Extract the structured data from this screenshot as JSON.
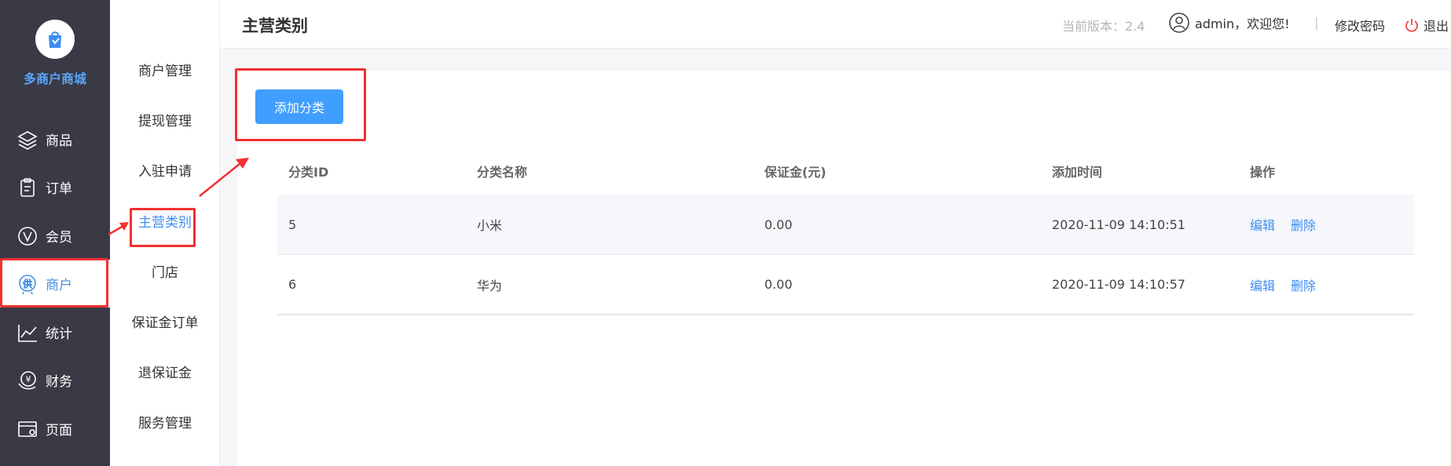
{
  "brand": {
    "name": "多商户商城",
    "logo_icon": "shopping-bag-icon"
  },
  "sidebar": {
    "items": [
      {
        "label": "商品",
        "icon": "layers-icon"
      },
      {
        "label": "订单",
        "icon": "clipboard-icon"
      },
      {
        "label": "会员",
        "icon": "vip-icon"
      },
      {
        "label": "商户",
        "icon": "supplier-icon",
        "active": true
      },
      {
        "label": "统计",
        "icon": "chart-icon"
      },
      {
        "label": "财务",
        "icon": "finance-icon"
      },
      {
        "label": "页面",
        "icon": "page-icon"
      }
    ]
  },
  "submenu": {
    "items": [
      {
        "label": "商户管理"
      },
      {
        "label": "提现管理"
      },
      {
        "label": "入驻申请"
      },
      {
        "label": "主营类别",
        "active": true
      },
      {
        "label": "门店"
      },
      {
        "label": "保证金订单"
      },
      {
        "label": "退保证金"
      },
      {
        "label": "服务管理"
      }
    ]
  },
  "header": {
    "title": "主营类别",
    "version": "当前版本：2.4",
    "user": "admin，欢迎您!",
    "separator": "|",
    "change_password": "修改密码",
    "logout": "退出"
  },
  "toolbar": {
    "add_label": "添加分类"
  },
  "table": {
    "columns": [
      "分类ID",
      "分类名称",
      "保证金(元)",
      "添加时间",
      "操作"
    ],
    "rows": [
      {
        "id": "5",
        "name": "小米",
        "deposit": "0.00",
        "time": "2020-11-09 14:10:51"
      },
      {
        "id": "6",
        "name": "华为",
        "deposit": "0.00",
        "time": "2020-11-09 14:10:57"
      }
    ],
    "actions": {
      "edit": "编辑",
      "delete": "删除"
    }
  },
  "colors": {
    "sidebar_bg": "#393a46",
    "accent": "#409eff",
    "annotation": "#f23030"
  }
}
